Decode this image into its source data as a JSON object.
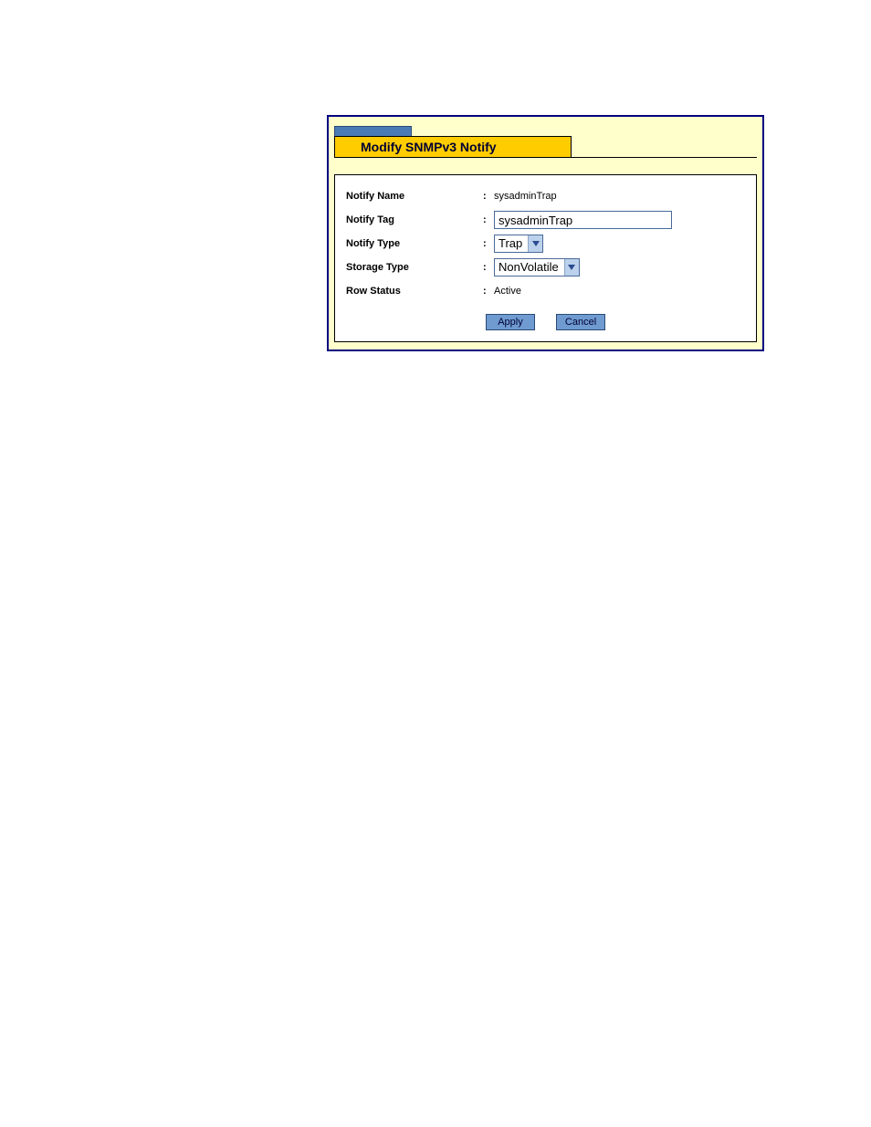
{
  "panel": {
    "title": "Modify SNMPv3 Notify"
  },
  "form": {
    "notify_name": {
      "label": "Notify Name",
      "value": "sysadminTrap"
    },
    "notify_tag": {
      "label": "Notify Tag",
      "value": "sysadminTrap"
    },
    "notify_type": {
      "label": "Notify Type",
      "value": "Trap"
    },
    "storage_type": {
      "label": "Storage Type",
      "value": "NonVolatile"
    },
    "row_status": {
      "label": "Row Status",
      "value": "Active"
    }
  },
  "buttons": {
    "apply": "Apply",
    "cancel": "Cancel"
  }
}
